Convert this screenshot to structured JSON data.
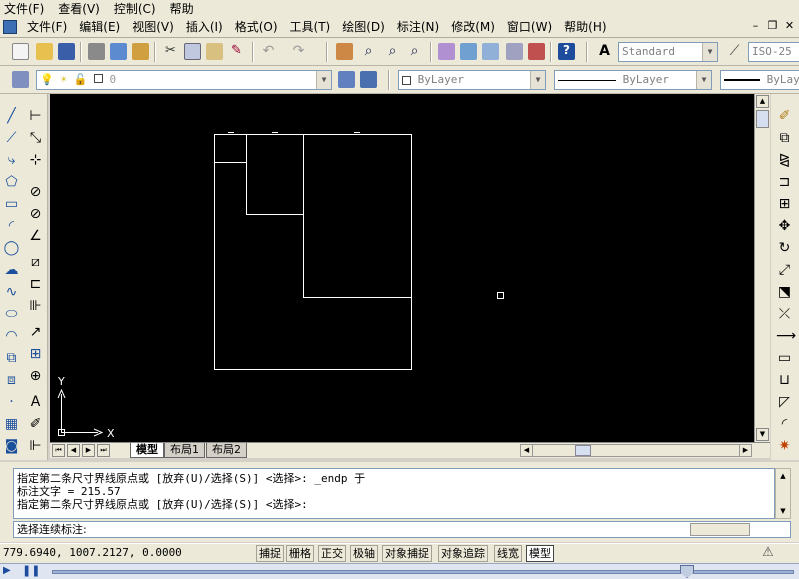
{
  "top_menu": [
    "文件(F)",
    "查看(V)",
    "控制(C)",
    "帮助"
  ],
  "menu": [
    "文件(F)",
    "编辑(E)",
    "视图(V)",
    "插入(I)",
    "格式(O)",
    "工具(T)",
    "绘图(D)",
    "标注(N)",
    "修改(M)",
    "窗口(W)",
    "帮助(H)"
  ],
  "toolbar": {
    "text_style": "Standard",
    "dim_style": "ISO-25",
    "layer_value": "0",
    "color": "ByLayer",
    "linetype": "ByLayer",
    "lineweight": "ByLayer"
  },
  "axes": {
    "y": "Y",
    "x": "X"
  },
  "tabs": [
    "模型",
    "布局1",
    "布局2"
  ],
  "command_history": [
    "指定第二条尺寸界线原点或 [放弃(U)/选择(S)] <选择>: _endp 于",
    "标注文字 = 215.57",
    "指定第二条尺寸界线原点或 [放弃(U)/选择(S)] <选择>:"
  ],
  "command_prompt": "选择连续标注:",
  "status": {
    "coords": "779.6940,  1007.2127, 0.0000",
    "buttons": [
      "捕捉",
      "栅格",
      "正交",
      "极轴",
      "对象捕捉",
      "对象追踪",
      "线宽",
      "模型"
    ]
  },
  "colors": {
    "canvas": "#000000",
    "ui": "#ece9d8"
  }
}
